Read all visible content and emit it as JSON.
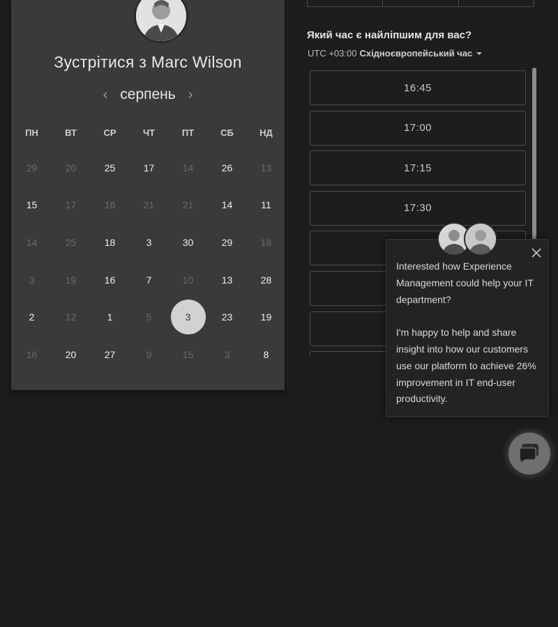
{
  "calendar": {
    "title_prefix": "Зустрітися з ",
    "host_name": "Marc Wilson",
    "month": "серпень",
    "prev_icon": "chevron-left-icon",
    "next_icon": "chevron-right-icon",
    "weekdays": [
      "ПН",
      "ВТ",
      "СР",
      "ЧТ",
      "ПТ",
      "СБ",
      "НД"
    ],
    "weeks": [
      [
        {
          "d": "29",
          "dim": true
        },
        {
          "d": "20",
          "dim": true
        },
        {
          "d": "25",
          "dim": false
        },
        {
          "d": "17",
          "dim": false
        },
        {
          "d": "14",
          "dim": true
        },
        {
          "d": "26",
          "dim": false
        },
        {
          "d": "13",
          "dim": true
        }
      ],
      [
        {
          "d": "15",
          "dim": false
        },
        {
          "d": "17",
          "dim": true
        },
        {
          "d": "16",
          "dim": true
        },
        {
          "d": "21",
          "dim": true
        },
        {
          "d": "21",
          "dim": true
        },
        {
          "d": "14",
          "dim": false
        },
        {
          "d": "11",
          "dim": false
        }
      ],
      [
        {
          "d": "14",
          "dim": true
        },
        {
          "d": "25",
          "dim": true
        },
        {
          "d": "18",
          "dim": false
        },
        {
          "d": "3",
          "dim": false
        },
        {
          "d": "30",
          "dim": false
        },
        {
          "d": "29",
          "dim": false
        },
        {
          "d": "18",
          "dim": true
        }
      ],
      [
        {
          "d": "3",
          "dim": true
        },
        {
          "d": "19",
          "dim": true
        },
        {
          "d": "16",
          "dim": false
        },
        {
          "d": "7",
          "dim": false
        },
        {
          "d": "10",
          "dim": true
        },
        {
          "d": "13",
          "dim": false
        },
        {
          "d": "28",
          "dim": false
        }
      ],
      [
        {
          "d": "2",
          "dim": false
        },
        {
          "d": "12",
          "dim": true
        },
        {
          "d": "1",
          "dim": false
        },
        {
          "d": "5",
          "dim": true
        },
        {
          "d": "3",
          "dim": false,
          "selected": true
        },
        {
          "d": "23",
          "dim": false
        },
        {
          "d": "19",
          "dim": false
        }
      ],
      [
        {
          "d": "16",
          "dim": true
        },
        {
          "d": "20",
          "dim": false
        },
        {
          "d": "27",
          "dim": false
        },
        {
          "d": "9",
          "dim": true
        },
        {
          "d": "15",
          "dim": true
        },
        {
          "d": "3",
          "dim": true
        },
        {
          "d": "8",
          "dim": false
        }
      ]
    ]
  },
  "times": {
    "question": "Який час є найліпшим для вас?",
    "tz_offset": "UTC +03:00",
    "tz_name": "Східноєвропейський час",
    "slots": [
      "16:45",
      "17:00",
      "17:15",
      "17:30",
      "",
      "",
      "",
      ""
    ]
  },
  "chat": {
    "message_1": "Interested how Experience Management could help your IT department?",
    "message_2": "I'm happy to help and share insight into how our customers use our platform to achieve 26% improvement in IT end-user productivity.",
    "close_icon": "close-icon",
    "launcher_icon": "chat-bubble-icon"
  },
  "colors": {
    "background": "#1c1c1c",
    "calendar_panel": "#3a3a3a",
    "selected_day": "#d2d2d2",
    "text": "#f0f0f0",
    "dim_text": "#6a6a6a"
  }
}
